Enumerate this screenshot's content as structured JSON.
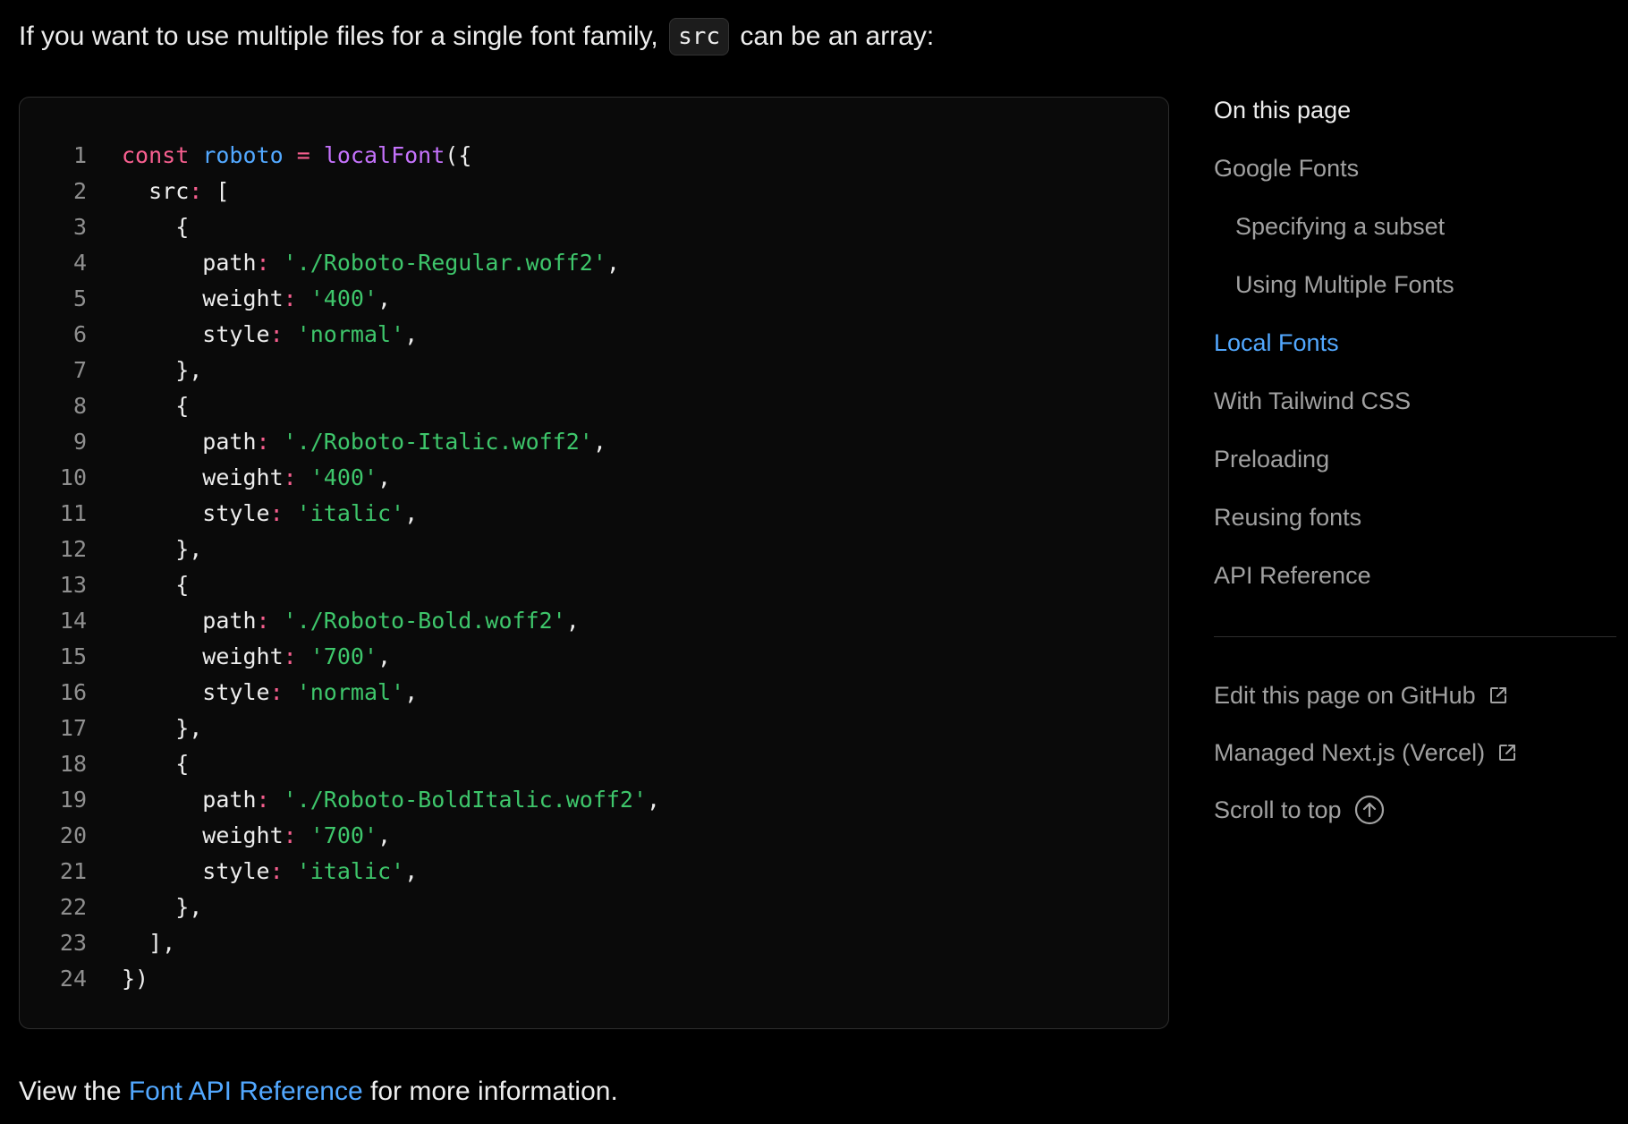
{
  "intro": {
    "before": "If you want to use multiple files for a single font family, ",
    "code": "src",
    "after": " can be an array:"
  },
  "code": {
    "lines": [
      [
        {
          "t": "keyword",
          "v": "const"
        },
        {
          "t": "punct",
          "v": " "
        },
        {
          "t": "variable",
          "v": "roboto"
        },
        {
          "t": "punct",
          "v": " "
        },
        {
          "t": "op",
          "v": "="
        },
        {
          "t": "punct",
          "v": " "
        },
        {
          "t": "function",
          "v": "localFont"
        },
        {
          "t": "punct",
          "v": "({"
        }
      ],
      [
        {
          "t": "prop",
          "v": "  src"
        },
        {
          "t": "op",
          "v": ":"
        },
        {
          "t": "punct",
          "v": " ["
        }
      ],
      [
        {
          "t": "punct",
          "v": "    {"
        }
      ],
      [
        {
          "t": "prop",
          "v": "      path"
        },
        {
          "t": "op",
          "v": ":"
        },
        {
          "t": "punct",
          "v": " "
        },
        {
          "t": "string",
          "v": "'./Roboto-Regular.woff2'"
        },
        {
          "t": "punct",
          "v": ","
        }
      ],
      [
        {
          "t": "prop",
          "v": "      weight"
        },
        {
          "t": "op",
          "v": ":"
        },
        {
          "t": "punct",
          "v": " "
        },
        {
          "t": "string",
          "v": "'400'"
        },
        {
          "t": "punct",
          "v": ","
        }
      ],
      [
        {
          "t": "prop",
          "v": "      style"
        },
        {
          "t": "op",
          "v": ":"
        },
        {
          "t": "punct",
          "v": " "
        },
        {
          "t": "string",
          "v": "'normal'"
        },
        {
          "t": "punct",
          "v": ","
        }
      ],
      [
        {
          "t": "punct",
          "v": "    },"
        }
      ],
      [
        {
          "t": "punct",
          "v": "    {"
        }
      ],
      [
        {
          "t": "prop",
          "v": "      path"
        },
        {
          "t": "op",
          "v": ":"
        },
        {
          "t": "punct",
          "v": " "
        },
        {
          "t": "string",
          "v": "'./Roboto-Italic.woff2'"
        },
        {
          "t": "punct",
          "v": ","
        }
      ],
      [
        {
          "t": "prop",
          "v": "      weight"
        },
        {
          "t": "op",
          "v": ":"
        },
        {
          "t": "punct",
          "v": " "
        },
        {
          "t": "string",
          "v": "'400'"
        },
        {
          "t": "punct",
          "v": ","
        }
      ],
      [
        {
          "t": "prop",
          "v": "      style"
        },
        {
          "t": "op",
          "v": ":"
        },
        {
          "t": "punct",
          "v": " "
        },
        {
          "t": "string",
          "v": "'italic'"
        },
        {
          "t": "punct",
          "v": ","
        }
      ],
      [
        {
          "t": "punct",
          "v": "    },"
        }
      ],
      [
        {
          "t": "punct",
          "v": "    {"
        }
      ],
      [
        {
          "t": "prop",
          "v": "      path"
        },
        {
          "t": "op",
          "v": ":"
        },
        {
          "t": "punct",
          "v": " "
        },
        {
          "t": "string",
          "v": "'./Roboto-Bold.woff2'"
        },
        {
          "t": "punct",
          "v": ","
        }
      ],
      [
        {
          "t": "prop",
          "v": "      weight"
        },
        {
          "t": "op",
          "v": ":"
        },
        {
          "t": "punct",
          "v": " "
        },
        {
          "t": "string",
          "v": "'700'"
        },
        {
          "t": "punct",
          "v": ","
        }
      ],
      [
        {
          "t": "prop",
          "v": "      style"
        },
        {
          "t": "op",
          "v": ":"
        },
        {
          "t": "punct",
          "v": " "
        },
        {
          "t": "string",
          "v": "'normal'"
        },
        {
          "t": "punct",
          "v": ","
        }
      ],
      [
        {
          "t": "punct",
          "v": "    },"
        }
      ],
      [
        {
          "t": "punct",
          "v": "    {"
        }
      ],
      [
        {
          "t": "prop",
          "v": "      path"
        },
        {
          "t": "op",
          "v": ":"
        },
        {
          "t": "punct",
          "v": " "
        },
        {
          "t": "string",
          "v": "'./Roboto-BoldItalic.woff2'"
        },
        {
          "t": "punct",
          "v": ","
        }
      ],
      [
        {
          "t": "prop",
          "v": "      weight"
        },
        {
          "t": "op",
          "v": ":"
        },
        {
          "t": "punct",
          "v": " "
        },
        {
          "t": "string",
          "v": "'700'"
        },
        {
          "t": "punct",
          "v": ","
        }
      ],
      [
        {
          "t": "prop",
          "v": "      style"
        },
        {
          "t": "op",
          "v": ":"
        },
        {
          "t": "punct",
          "v": " "
        },
        {
          "t": "string",
          "v": "'italic'"
        },
        {
          "t": "punct",
          "v": ","
        }
      ],
      [
        {
          "t": "punct",
          "v": "    },"
        }
      ],
      [
        {
          "t": "punct",
          "v": "  ],"
        }
      ],
      [
        {
          "t": "punct",
          "v": "})"
        }
      ]
    ]
  },
  "toc": {
    "title": "On this page",
    "items": [
      {
        "label": "Google Fonts",
        "level": 1,
        "active": false
      },
      {
        "label": "Specifying a subset",
        "level": 2,
        "active": false
      },
      {
        "label": "Using Multiple Fonts",
        "level": 2,
        "active": false
      },
      {
        "label": "Local Fonts",
        "level": 1,
        "active": true
      },
      {
        "label": "With Tailwind CSS",
        "level": 1,
        "active": false
      },
      {
        "label": "Preloading",
        "level": 1,
        "active": false
      },
      {
        "label": "Reusing fonts",
        "level": 1,
        "active": false
      },
      {
        "label": "API Reference",
        "level": 1,
        "active": false
      }
    ],
    "links": {
      "edit_github": "Edit this page on GitHub",
      "managed_nextjs": "Managed Next.js (Vercel)",
      "scroll_top": "Scroll to top"
    }
  },
  "outro": {
    "before": "View the ",
    "link": "Font API Reference",
    "after": " for more information."
  },
  "colors": {
    "background": "#000000",
    "text": "#ededed",
    "muted": "#a1a1a1",
    "accent": "#52a8ff",
    "keyword": "#f75f8f",
    "function": "#c472fb",
    "string": "#3ec66b"
  }
}
